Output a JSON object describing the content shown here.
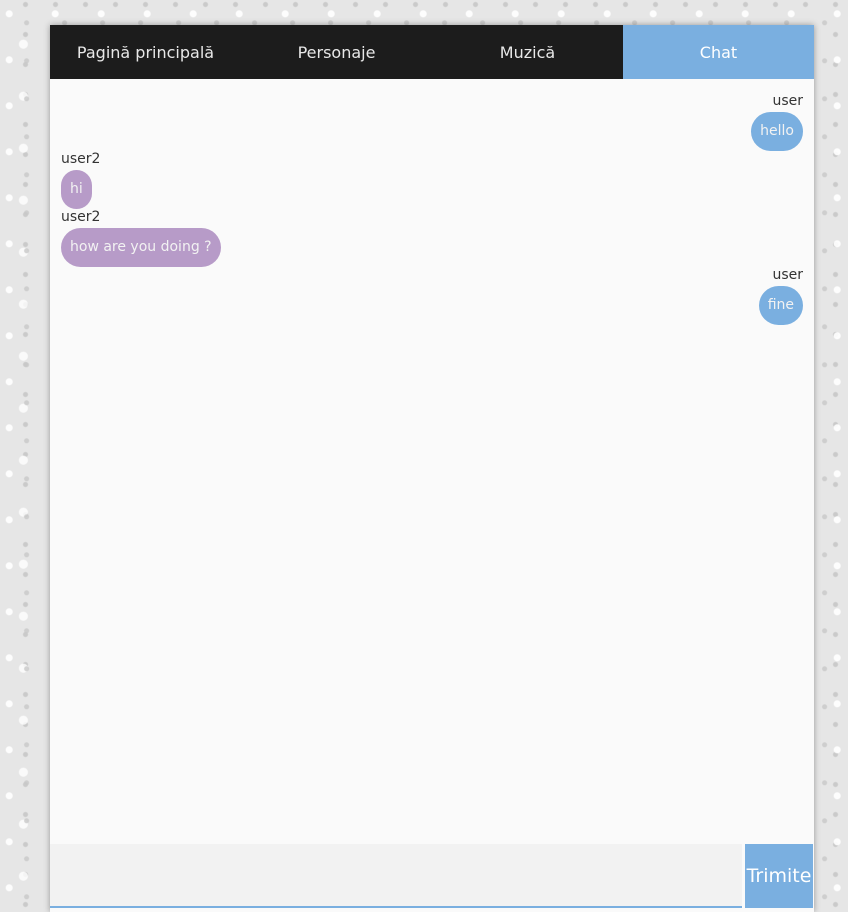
{
  "nav": {
    "items": [
      {
        "label": "Pagină principală"
      },
      {
        "label": "Personaje"
      },
      {
        "label": "Muzică"
      },
      {
        "label": "Chat"
      }
    ],
    "active": "Chat"
  },
  "messages": [
    {
      "sender": "user",
      "text": "hello",
      "side": "right"
    },
    {
      "sender": "user2",
      "text": "hi",
      "side": "left"
    },
    {
      "sender": "user2",
      "text": "how are you doing ?",
      "side": "left"
    },
    {
      "sender": "user",
      "text": "fine",
      "side": "right"
    }
  ],
  "composer": {
    "input_value": "",
    "input_placeholder": "",
    "send_label": "Trimite"
  },
  "colors": {
    "accent": "#7aafe0",
    "other_bubble": "#b79bc8",
    "nav_background": "#1c1c1c"
  }
}
